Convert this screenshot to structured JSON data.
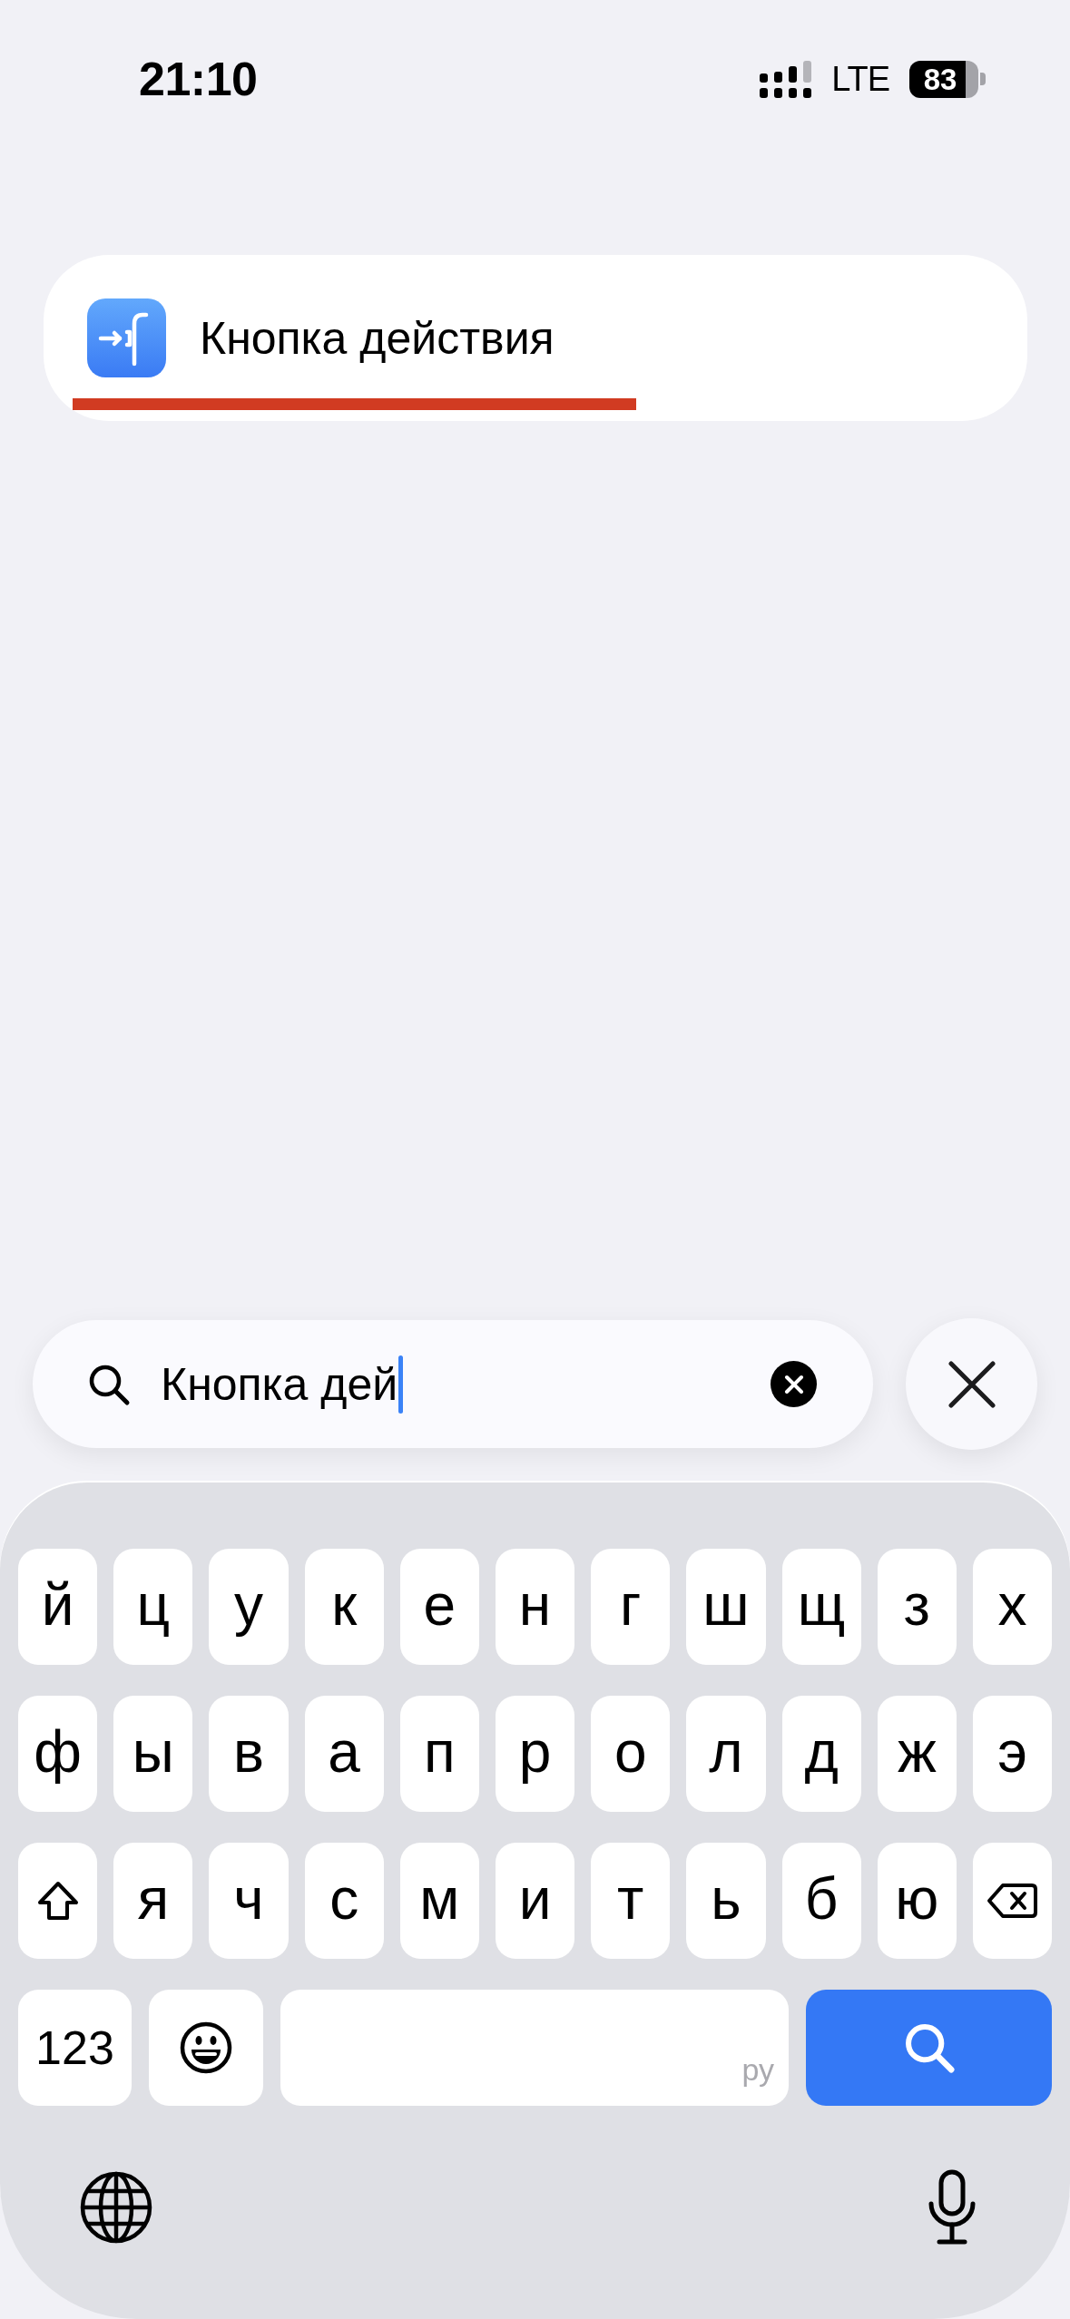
{
  "status_bar": {
    "time": "21:10",
    "network": "LTE",
    "battery": "83"
  },
  "results": [
    {
      "title": "Кнопка действия",
      "underlined": true
    }
  ],
  "search": {
    "value": "Кнопка дей",
    "focused": true
  },
  "keyboard": {
    "rows": [
      [
        {
          "kind": "char",
          "label": "й"
        },
        {
          "kind": "char",
          "label": "ц"
        },
        {
          "kind": "char",
          "label": "у"
        },
        {
          "kind": "char",
          "label": "к"
        },
        {
          "kind": "char",
          "label": "е"
        },
        {
          "kind": "char",
          "label": "н"
        },
        {
          "kind": "char",
          "label": "г"
        },
        {
          "kind": "char",
          "label": "ш"
        },
        {
          "kind": "char",
          "label": "щ"
        },
        {
          "kind": "char",
          "label": "з"
        },
        {
          "kind": "char",
          "label": "х"
        }
      ],
      [
        {
          "kind": "char",
          "label": "ф"
        },
        {
          "kind": "char",
          "label": "ы"
        },
        {
          "kind": "char",
          "label": "в"
        },
        {
          "kind": "char",
          "label": "а"
        },
        {
          "kind": "char",
          "label": "п"
        },
        {
          "kind": "char",
          "label": "р"
        },
        {
          "kind": "char",
          "label": "о"
        },
        {
          "kind": "char",
          "label": "л"
        },
        {
          "kind": "char",
          "label": "д"
        },
        {
          "kind": "char",
          "label": "ж"
        },
        {
          "kind": "char",
          "label": "э"
        }
      ],
      [
        {
          "kind": "shift"
        },
        {
          "kind": "char",
          "label": "я"
        },
        {
          "kind": "char",
          "label": "ч"
        },
        {
          "kind": "char",
          "label": "с"
        },
        {
          "kind": "char",
          "label": "м"
        },
        {
          "kind": "char",
          "label": "и"
        },
        {
          "kind": "char",
          "label": "т"
        },
        {
          "kind": "char",
          "label": "ь"
        },
        {
          "kind": "char",
          "label": "б"
        },
        {
          "kind": "char",
          "label": "ю"
        },
        {
          "kind": "backspace"
        }
      ],
      [
        {
          "kind": "numbers",
          "label": "123"
        },
        {
          "kind": "emoji"
        },
        {
          "kind": "space",
          "label": "ру"
        },
        {
          "kind": "search"
        }
      ]
    ]
  }
}
